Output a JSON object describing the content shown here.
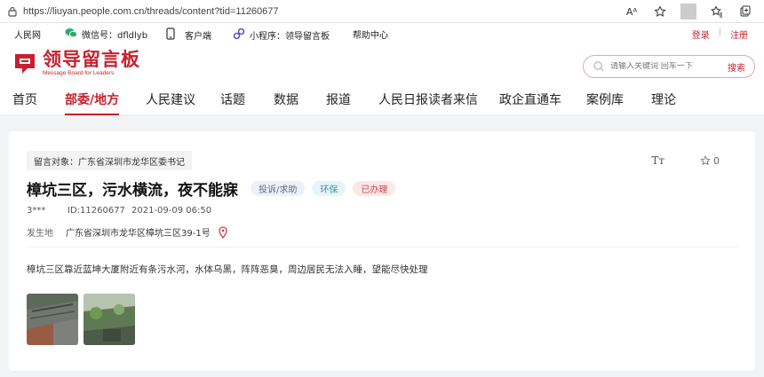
{
  "browser": {
    "url": "https://liuyan.people.com.cn/threads/content?tid=11260677"
  },
  "util": {
    "people_net": "人民网",
    "wechat": "微信号：dfldlyb",
    "client": "客户端",
    "miniprogram": "小程序：领导留言板",
    "help": "帮助中心",
    "login": "登录",
    "separator": "|",
    "register": "注册"
  },
  "header": {
    "logo_title": "领导留言板",
    "logo_sub": "Message Board for Leaders",
    "search_placeholder": "请输入关键词 回车一下",
    "search_button": "搜索"
  },
  "nav": {
    "items": [
      {
        "label": "首页"
      },
      {
        "label": "部委/地方"
      },
      {
        "label": "人民建议"
      },
      {
        "label": "话题"
      },
      {
        "label": "数据"
      },
      {
        "label": "报道"
      },
      {
        "label": "人民日报读者来信"
      },
      {
        "label": "政企直通车"
      },
      {
        "label": "案例库"
      },
      {
        "label": "理论"
      }
    ],
    "active_index": 1
  },
  "post": {
    "target": "留言对象：广东省深圳市龙华区委书记",
    "font_tool": "Tт",
    "fav_count": "0",
    "title": "樟坑三区，污水横流，夜不能寐",
    "badge_type": "投诉/求助",
    "badge_topic": "环保",
    "badge_status": "已办理",
    "user": "3***",
    "id": "ID:11260677",
    "time": "2021-09-09 06:50",
    "location_label": "发生地",
    "location": "广东省深圳市龙华区樟坑三区39-1号",
    "body": "樟坑三区靠近蓝坤大厦附近有条污水河，水体乌黑，阵阵恶臭，周边居民无法入睡，望能尽快处理"
  },
  "colors": {
    "brand_red": "#c8202d",
    "badge_type_bg": "#eef1f7",
    "badge_topic_bg": "#e7f4f8",
    "badge_status_bg": "#fde8e9"
  }
}
